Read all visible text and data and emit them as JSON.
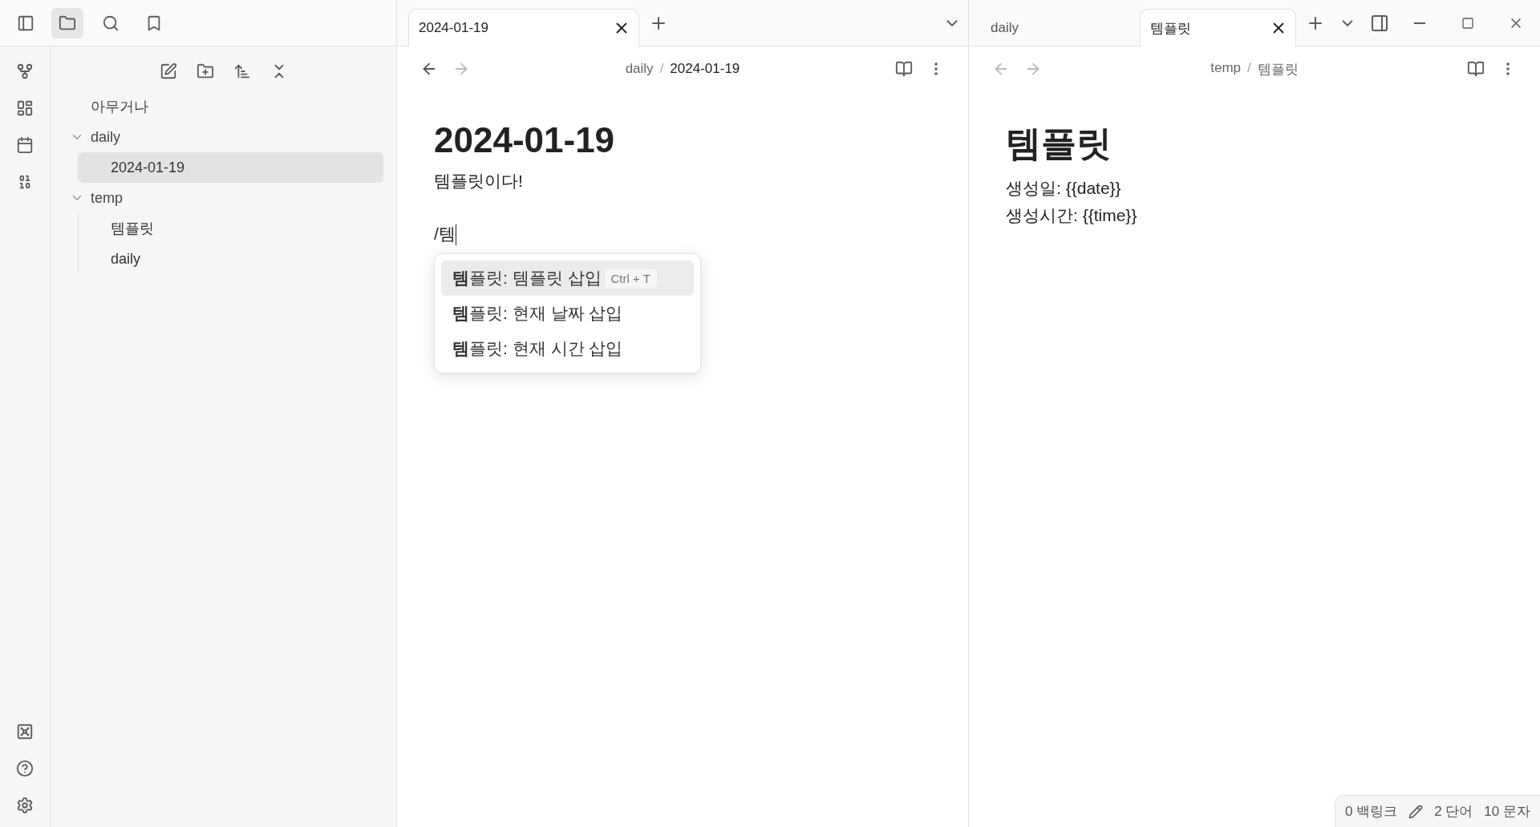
{
  "sidebar_tabs": [
    {
      "kind": "files",
      "selected": true
    },
    {
      "kind": "search",
      "selected": false
    },
    {
      "kind": "bookmarks",
      "selected": false
    }
  ],
  "file_tree": [
    {
      "label": "아무거나",
      "selected": false
    },
    {
      "label": "daily",
      "expanded": true,
      "selected": false,
      "children": [
        {
          "label": "2024-01-19",
          "selected": true
        }
      ]
    },
    {
      "label": "temp",
      "expanded": true,
      "selected": false,
      "children": [
        {
          "label": "템플릿",
          "selected": false
        },
        {
          "label": "daily",
          "selected": false
        }
      ]
    }
  ],
  "panes": [
    {
      "tabs": [
        {
          "label": "2024-01-19",
          "selected": true
        }
      ],
      "can_go_back": true,
      "breadcrumb": {
        "folder": "daily",
        "separator": "/",
        "file": "2024-01-19"
      },
      "title": "2024-01-19",
      "lines": [
        "템플릿이다!",
        "/템"
      ],
      "suggestions": [
        {
          "text": "**템**플릿: 템플릿 삽입",
          "hotkey": "Ctrl + T",
          "selected": true
        },
        {
          "text": "**템**플릿: 현재 날짜 삽입",
          "selected": false
        },
        {
          "text": "**템**플릿: 현재 시간 삽입",
          "selected": false
        }
      ]
    },
    {
      "tabs": [
        {
          "label": "daily",
          "selected": false
        },
        {
          "label": "템플릿",
          "selected": true
        }
      ],
      "can_go_back": false,
      "breadcrumb": {
        "folder": "temp",
        "separator": "/",
        "file": "템플릿"
      },
      "title": "템플릿",
      "lines": [
        "생성일: {{date}}",
        "생성시간: {{time}}"
      ],
      "status_bar": {
        "backlinks": "0 백링크",
        "words": "2 단어",
        "characters": "10 문자"
      }
    }
  ]
}
